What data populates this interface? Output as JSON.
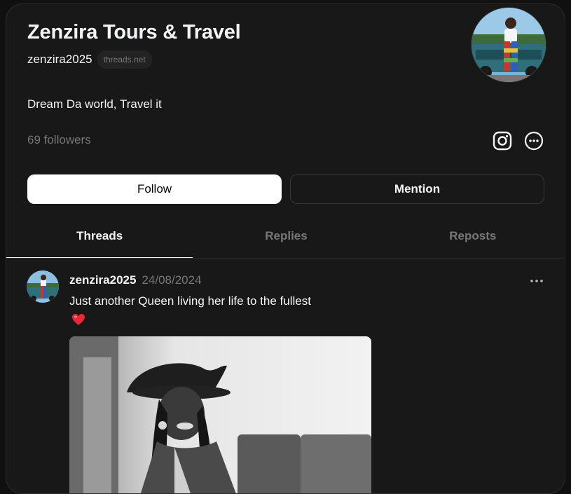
{
  "profile": {
    "name": "Zenzira Tours & Travel",
    "handle": "zenzira2025",
    "domain": "threads.net",
    "bio": "Dream Da world, Travel it",
    "followers": "69 followers",
    "avatar_icon": "profile-photo"
  },
  "icons": {
    "instagram": "instagram-icon",
    "more": "more-options-icon"
  },
  "buttons": {
    "follow": "Follow",
    "mention": "Mention"
  },
  "tabs": [
    {
      "label": "Threads",
      "active": true
    },
    {
      "label": "Replies",
      "active": false
    },
    {
      "label": "Reposts",
      "active": false
    }
  ],
  "post": {
    "user": "zenzira2025",
    "date": "24/08/2024",
    "text": "Just another Queen living her life to the fullest",
    "emoji": "heart-icon"
  },
  "colors": {
    "background": "#101010",
    "card": "#181818",
    "primary_text": "#f3f5f7",
    "secondary_text": "#777777",
    "border": "#2d2d2d",
    "heart": "#e8283a"
  }
}
